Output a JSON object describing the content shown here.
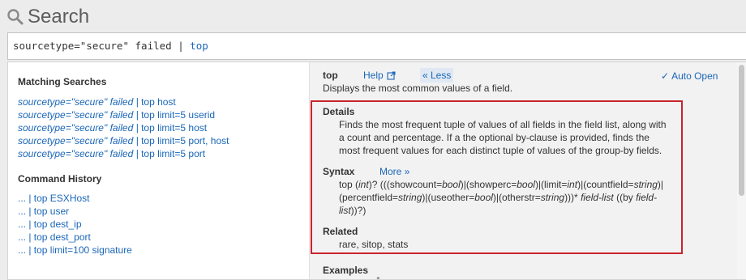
{
  "header": {
    "title": "Search",
    "icon": "search-icon"
  },
  "search": {
    "query_prefix": "sourcetype=\"secure\" failed | ",
    "query_command": "top"
  },
  "matching": {
    "heading": "Matching Searches",
    "items": [
      {
        "italic": "sourcetype=\"secure\" failed | ",
        "normal": "top host"
      },
      {
        "italic": "sourcetype=\"secure\" failed | ",
        "normal": "top limit=5 userid"
      },
      {
        "italic": "sourcetype=\"secure\" failed | ",
        "normal": "top limit=5 host"
      },
      {
        "italic": "sourcetype=\"secure\" failed | ",
        "normal": "top limit=5 port, host"
      },
      {
        "italic": "sourcetype=\"secure\" failed | ",
        "normal": "top limit=5 port"
      }
    ]
  },
  "history": {
    "heading": "Command History",
    "items": [
      "... | top ESXHost",
      "... | top user",
      "... | top dest_ip",
      "... | top dest_port",
      "... | top limit=100 signature"
    ]
  },
  "help_panel": {
    "command": "top",
    "help_label": "Help",
    "less_label": "« Less",
    "auto_open_label": "Auto Open",
    "description": "Displays the most common values of a field.",
    "details_label": "Details",
    "details_text": "Finds the most frequent tuple of values of all fields in the field list, along with a count and percentage. If a the optional by-clause is provided, finds the most frequent values for each distinct tuple of values of the group-by fields.",
    "syntax_label": "Syntax",
    "more_label": "More »",
    "syntax_line1": "top (int)? (((showcount=bool)|(showperc=bool)|(limit=int)|(countfield=string)|",
    "syntax_line2": "(percentfield=string)|(useother=bool)|(otherstr=string)))* field-list ((by field-",
    "syntax_line3": "list))?)",
    "related_label": "Related",
    "related_text": "rare, sitop, stats",
    "examples_label": "Examples",
    "highlight_color": "#c9242c",
    "link_color": "#1a66b8"
  }
}
